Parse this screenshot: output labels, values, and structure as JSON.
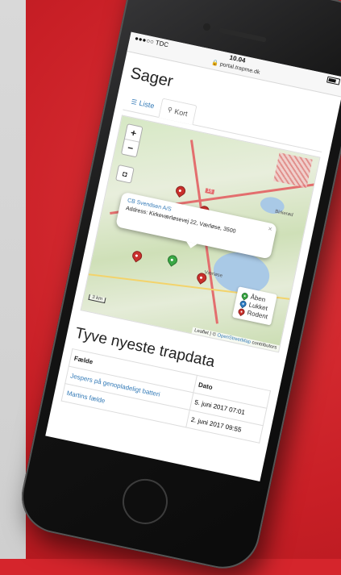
{
  "status_bar": {
    "carrier": "●●●○○ TDC",
    "time": "10.04",
    "url": "portal.trapme.dk"
  },
  "page": {
    "title": "Sager"
  },
  "tabs": [
    {
      "label": "Liste",
      "icon": "list-icon"
    },
    {
      "label": "Kort",
      "icon": "map-marker-icon",
      "active": true
    }
  ],
  "map": {
    "zoom_in": "+",
    "zoom_out": "−",
    "locate": "◘",
    "road_label": "16",
    "place_labels": [
      "Birkerød",
      "Værløse"
    ],
    "popup": {
      "name": "CB Svendsen A/S",
      "address": "Address: Kirkeværløsevej 22, Værløse, 3500",
      "close": "×"
    },
    "legend": [
      {
        "label": "Åben",
        "color": "#3aa845"
      },
      {
        "label": "Lukket",
        "color": "#2f7ec6"
      },
      {
        "label": "Rodent",
        "color": "#c9302c"
      }
    ],
    "scale": "3 km",
    "attribution_prefix": "Leaflet | © ",
    "attribution_link": "OpenStreetMap",
    "attribution_suffix": " contributors"
  },
  "section": {
    "title": "Tyve nyeste trapdata"
  },
  "table": {
    "headers": [
      "Fælde",
      "Dato"
    ],
    "rows": [
      {
        "trap": "Jespers på genopladeligt batteri",
        "date": "5. juni 2017 07:01"
      },
      {
        "trap": "Martins fælde",
        "date": "2. juni 2017 09:55"
      }
    ]
  }
}
